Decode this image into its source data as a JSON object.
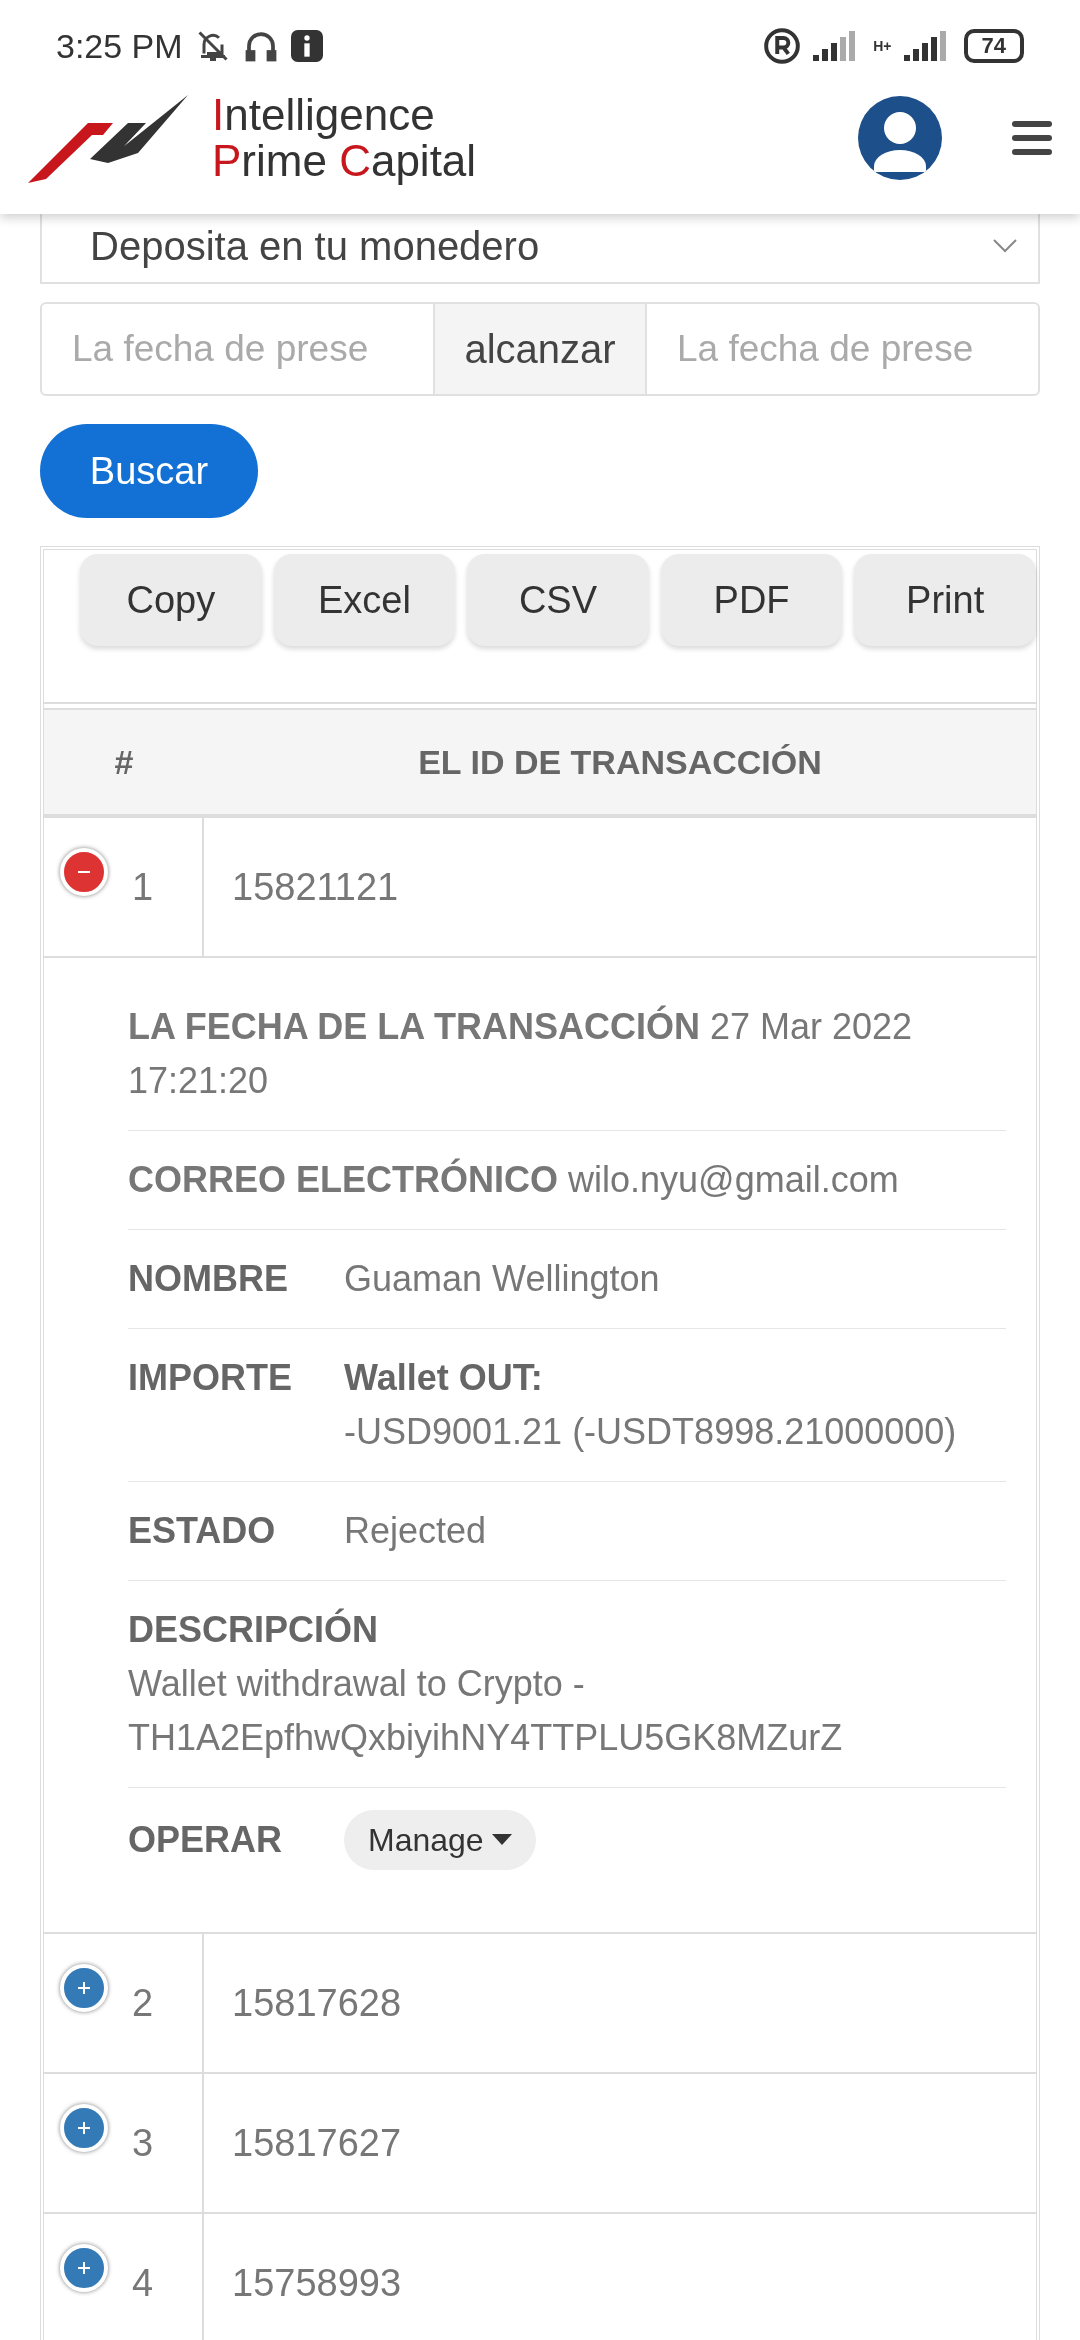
{
  "status_bar": {
    "time": "3:25 PM",
    "network_type": "H+",
    "battery": "74"
  },
  "logo": {
    "lines": [
      [
        {
          "text": "I",
          "accent": true
        },
        {
          "text": "ntelligence",
          "accent": false
        }
      ],
      [
        {
          "text": "P",
          "accent": true
        },
        {
          "text": "rime ",
          "accent": false
        },
        {
          "text": "C",
          "accent": true
        },
        {
          "text": "apital",
          "accent": false
        }
      ]
    ]
  },
  "filter": {
    "select_value": "Deposita en tu monedero",
    "date_from": {
      "placeholder": "La fecha de prese"
    },
    "range_label": "alcanzar",
    "date_to": {
      "placeholder": "La fecha de prese"
    },
    "search_button": "Buscar"
  },
  "export_buttons": [
    "Copy",
    "Excel",
    "CSV",
    "PDF",
    "Print"
  ],
  "table": {
    "columns": [
      "#",
      "EL ID DE TRANSACCIÓN"
    ],
    "rows": [
      {
        "index": "1",
        "id": "15821121",
        "expanded": true,
        "details": [
          {
            "kind": "inline",
            "label": "LA FECHA DE LA TRANSACCIÓN",
            "value": "27 Mar 2022 17:21:20"
          },
          {
            "kind": "inline",
            "label": "CORREO ELECTRÓNICO",
            "value": "wilo.nyu@gmail.com"
          },
          {
            "kind": "column",
            "label": "NOMBRE",
            "value": "Guaman Wellington"
          },
          {
            "kind": "column",
            "label": "IMPORTE",
            "value": "**Wallet OUT:**\n-USD9001.21 (-USDT8998.21000000)"
          },
          {
            "kind": "column",
            "label": "ESTADO",
            "value": "Rejected"
          },
          {
            "kind": "stacked",
            "label": "DESCRIPCIÓN",
            "value": "Wallet withdrawal to Crypto - TH1A2EpfhwQxbiyihNY4TTPLU5GK8MZurZ"
          },
          {
            "kind": "action",
            "label": "OPERAR",
            "value": "Manage"
          }
        ]
      },
      {
        "index": "2",
        "id": "15817628",
        "expanded": false
      },
      {
        "index": "3",
        "id": "15817627",
        "expanded": false
      },
      {
        "index": "4",
        "id": "15758993",
        "expanded": false
      }
    ]
  }
}
